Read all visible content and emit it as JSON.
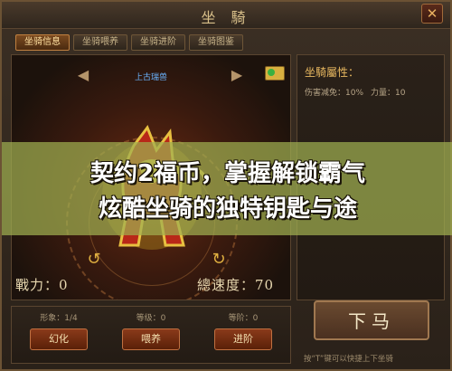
{
  "window": {
    "title": "坐 騎",
    "close_symbol": "✕"
  },
  "tabs": [
    {
      "label": "坐骑信息",
      "active": true
    },
    {
      "label": "坐骑喂养",
      "active": false
    },
    {
      "label": "坐骑进阶",
      "active": false
    },
    {
      "label": "坐骑图鉴",
      "active": false
    }
  ],
  "mount": {
    "name": "上古瑞兽",
    "power_label": "戰力：0",
    "speed_label": "總速度：70"
  },
  "attributes": {
    "title": "坐騎屬性：",
    "damage_reduction": "伤害减免：10%",
    "strength": "力量：10"
  },
  "slots": [
    {
      "info": "形象：1/4",
      "button": "幻化"
    },
    {
      "info": "等级：0",
      "button": "喂养"
    },
    {
      "info": "等阶：0",
      "button": "进阶"
    }
  ],
  "actions": {
    "dismount": "下马",
    "hint": "按“T”键可以快捷上下坐骑"
  },
  "banner": {
    "line1": "契约2福币，掌握解锁霸气",
    "line2": "炫酷坐骑的独特钥匙与途"
  },
  "colors": {
    "accent_gold": "#e8b860",
    "tab_active": "#7a4a20",
    "button_red": "#8a3a1a",
    "banner_overlay": "#a0af50",
    "mount_name_blue": "#6ab4ff"
  },
  "icons": [
    "close-icon",
    "arrow-left-icon",
    "arrow-right-icon",
    "mail-icon",
    "rotate-left-icon",
    "rotate-right-icon"
  ]
}
